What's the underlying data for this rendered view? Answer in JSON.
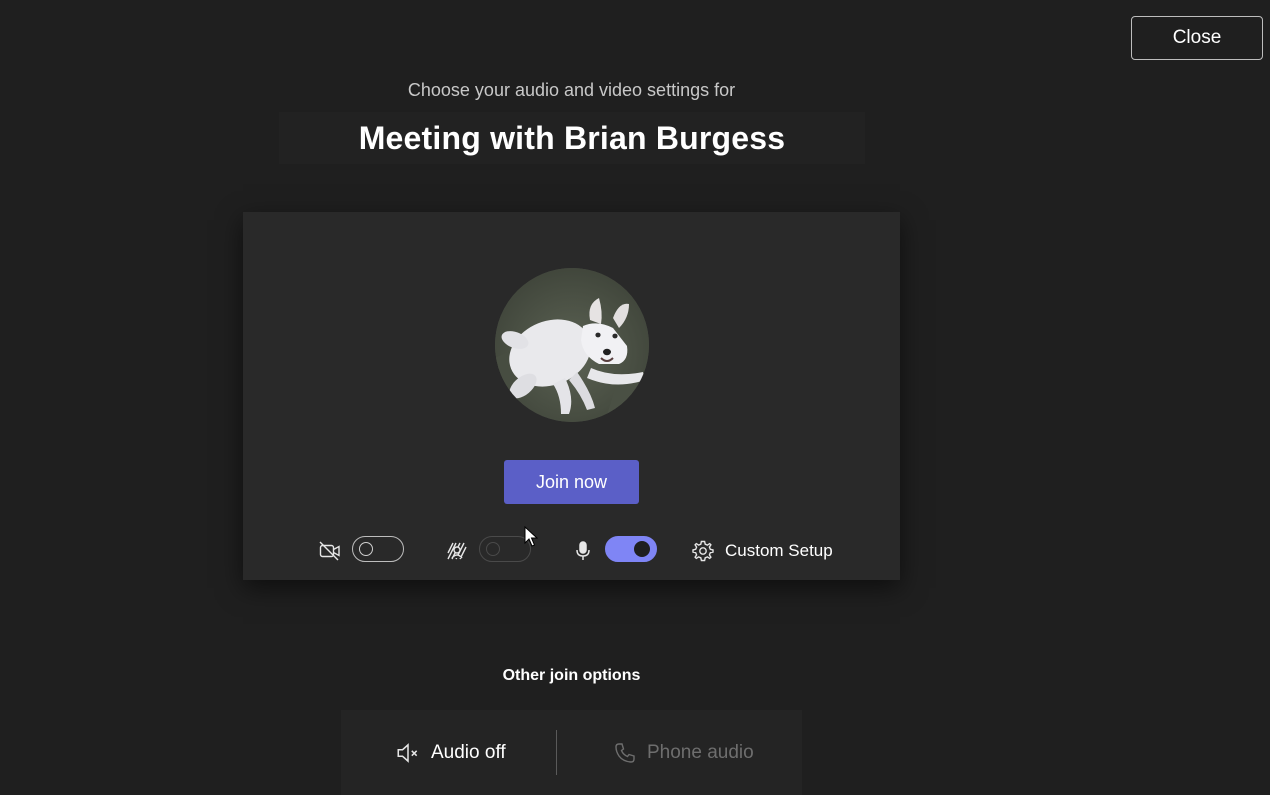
{
  "header": {
    "close_label": "Close",
    "subtitle": "Choose your audio and video settings for",
    "meeting_title": "Meeting with Brian Burgess"
  },
  "card": {
    "join_label": "Join now",
    "controls": {
      "camera": {
        "icon": "camera-off-icon",
        "enabled": false
      },
      "background_effects": {
        "icon": "background-effects-icon",
        "enabled": false,
        "disabled": true
      },
      "microphone": {
        "icon": "microphone-icon",
        "enabled": true
      },
      "custom_setup_label": "Custom Setup"
    }
  },
  "other_options": {
    "label": "Other join options",
    "audio_off_label": "Audio off",
    "phone_audio_label": "Phone audio"
  },
  "colors": {
    "accent": "#5b5fc7",
    "toggle_on": "#7f85f5",
    "background": "#1f1f1f",
    "card": "#292929"
  }
}
